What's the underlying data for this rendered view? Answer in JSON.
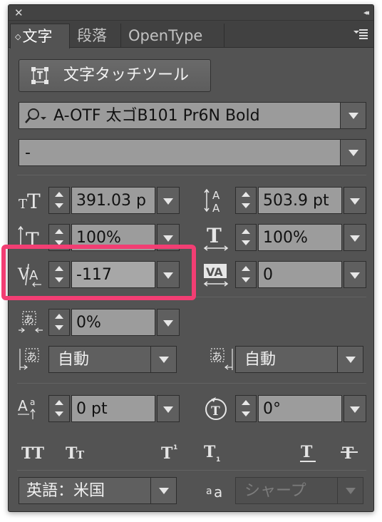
{
  "window": {
    "close_glyph": "✕",
    "collapse_glyph": "◂◂"
  },
  "tabs": [
    {
      "label": "文字",
      "active": true
    },
    {
      "label": "段落",
      "active": false
    },
    {
      "label": "OpenType",
      "active": false
    }
  ],
  "touch_type_button": {
    "label": "文字タッチツール",
    "icon": "touch-type-icon"
  },
  "font_family": {
    "value": "A-OTF 太ゴB101 Pr6N Bold",
    "icon": "font-search-icon"
  },
  "font_style": {
    "value": "-"
  },
  "fields": {
    "font_size": "391.03 p",
    "leading": "503.9 pt",
    "vertical_scale": "100%",
    "horizontal_scale": "100%",
    "kerning": "-117",
    "tracking": "0",
    "tsume": "0%",
    "aki_left": "自動",
    "aki_right": "自動",
    "baseline_shift": "0 pt",
    "character_rotation": "0°"
  },
  "language": {
    "value": "英語：米国"
  },
  "antialiasing": {
    "value": "シャープ",
    "disabled": true
  },
  "colors": {
    "highlight": "#f23e73",
    "panel": "#535353",
    "field": "#9c9c9c"
  }
}
